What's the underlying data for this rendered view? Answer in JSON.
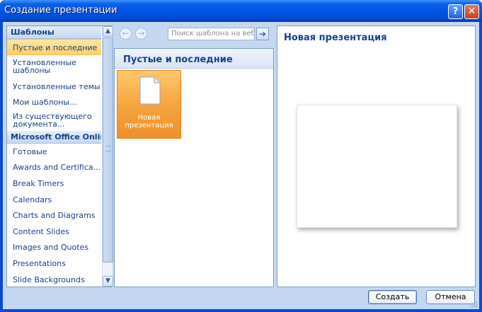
{
  "window": {
    "title": "Создание презентации",
    "help_label": "?",
    "close_label": "✕"
  },
  "left": {
    "header_templates": "Шаблоны",
    "items": [
      {
        "label": "Пустые и последние",
        "selected": true
      },
      {
        "label": "Установленные шаблоны"
      },
      {
        "label": "Установленные темы"
      },
      {
        "label": "Мои шаблоны..."
      },
      {
        "label": "Из существующего документа..."
      }
    ],
    "header_online": "Microsoft Office Online",
    "online_items": [
      {
        "label": "Готовые"
      },
      {
        "label": "Awards and Certifica..."
      },
      {
        "label": "Break Timers"
      },
      {
        "label": "Calendars"
      },
      {
        "label": "Charts and Diagrams"
      },
      {
        "label": "Content Slides"
      },
      {
        "label": "Images and Quotes"
      },
      {
        "label": "Presentations"
      },
      {
        "label": "Slide Backgrounds"
      }
    ],
    "scroll_up": "▲",
    "scroll_down": "▼"
  },
  "nav": {
    "back": "←",
    "forward": "→",
    "search_placeholder": "Поиск шаблона на веб",
    "search_go": "➔"
  },
  "middle": {
    "section_title": "Пустые и последние",
    "tile_label_line1": "Новая",
    "tile_label_line2": "презентация"
  },
  "right": {
    "title": "Новая презентация"
  },
  "buttons": {
    "create": "Создать",
    "cancel": "Отмена"
  },
  "colors": {
    "titlebar": "#0055e5",
    "client_bg": "#c5d8f2",
    "selection": "#ffd068",
    "tile": "#f6a23c",
    "text": "#15428b"
  }
}
